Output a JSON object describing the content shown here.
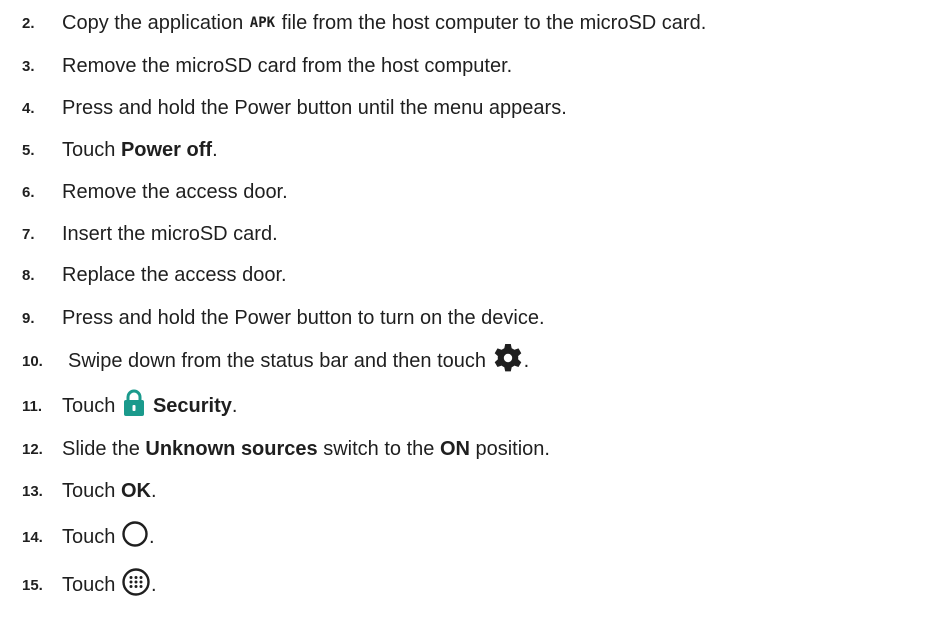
{
  "steps": [
    {
      "num": "2.",
      "a": "Copy the application ",
      "code": "APK",
      "b": " file from the host computer to the microSD card."
    },
    {
      "num": "3.",
      "text": "Remove the microSD card from the host computer."
    },
    {
      "num": "4.",
      "text": "Press and hold the Power button until the menu appears."
    },
    {
      "num": "5.",
      "a": "Touch ",
      "bold": "Power off",
      "b": "."
    },
    {
      "num": "6.",
      "text": "Remove the access door."
    },
    {
      "num": "7.",
      "text": "Insert the microSD card."
    },
    {
      "num": "8.",
      "text": "Replace the access door."
    },
    {
      "num": "9.",
      "text": "Press and hold the Power button to turn on the device."
    },
    {
      "num": "10.",
      "a": "Swipe down from the status bar and then touch ",
      "icon": "gear-icon",
      "b": "."
    },
    {
      "num": "11.",
      "a": "Touch ",
      "icon": "lock-icon",
      "bold": "Security",
      "b": "."
    },
    {
      "num": "12.",
      "a": "Slide the ",
      "bold": "Unknown sources",
      "c": " switch to the ",
      "bold2": "ON",
      "b": " position."
    },
    {
      "num": "13.",
      "a": "Touch ",
      "bold": "OK",
      "b": "."
    },
    {
      "num": "14.",
      "a": "Touch ",
      "icon": "home-circle-icon",
      "b": "."
    },
    {
      "num": "15.",
      "a": "Touch ",
      "icon": "apps-icon",
      "b": "."
    }
  ],
  "colors": {
    "text": "#1f1f1f",
    "lock_icon": "#1a9a8c"
  }
}
